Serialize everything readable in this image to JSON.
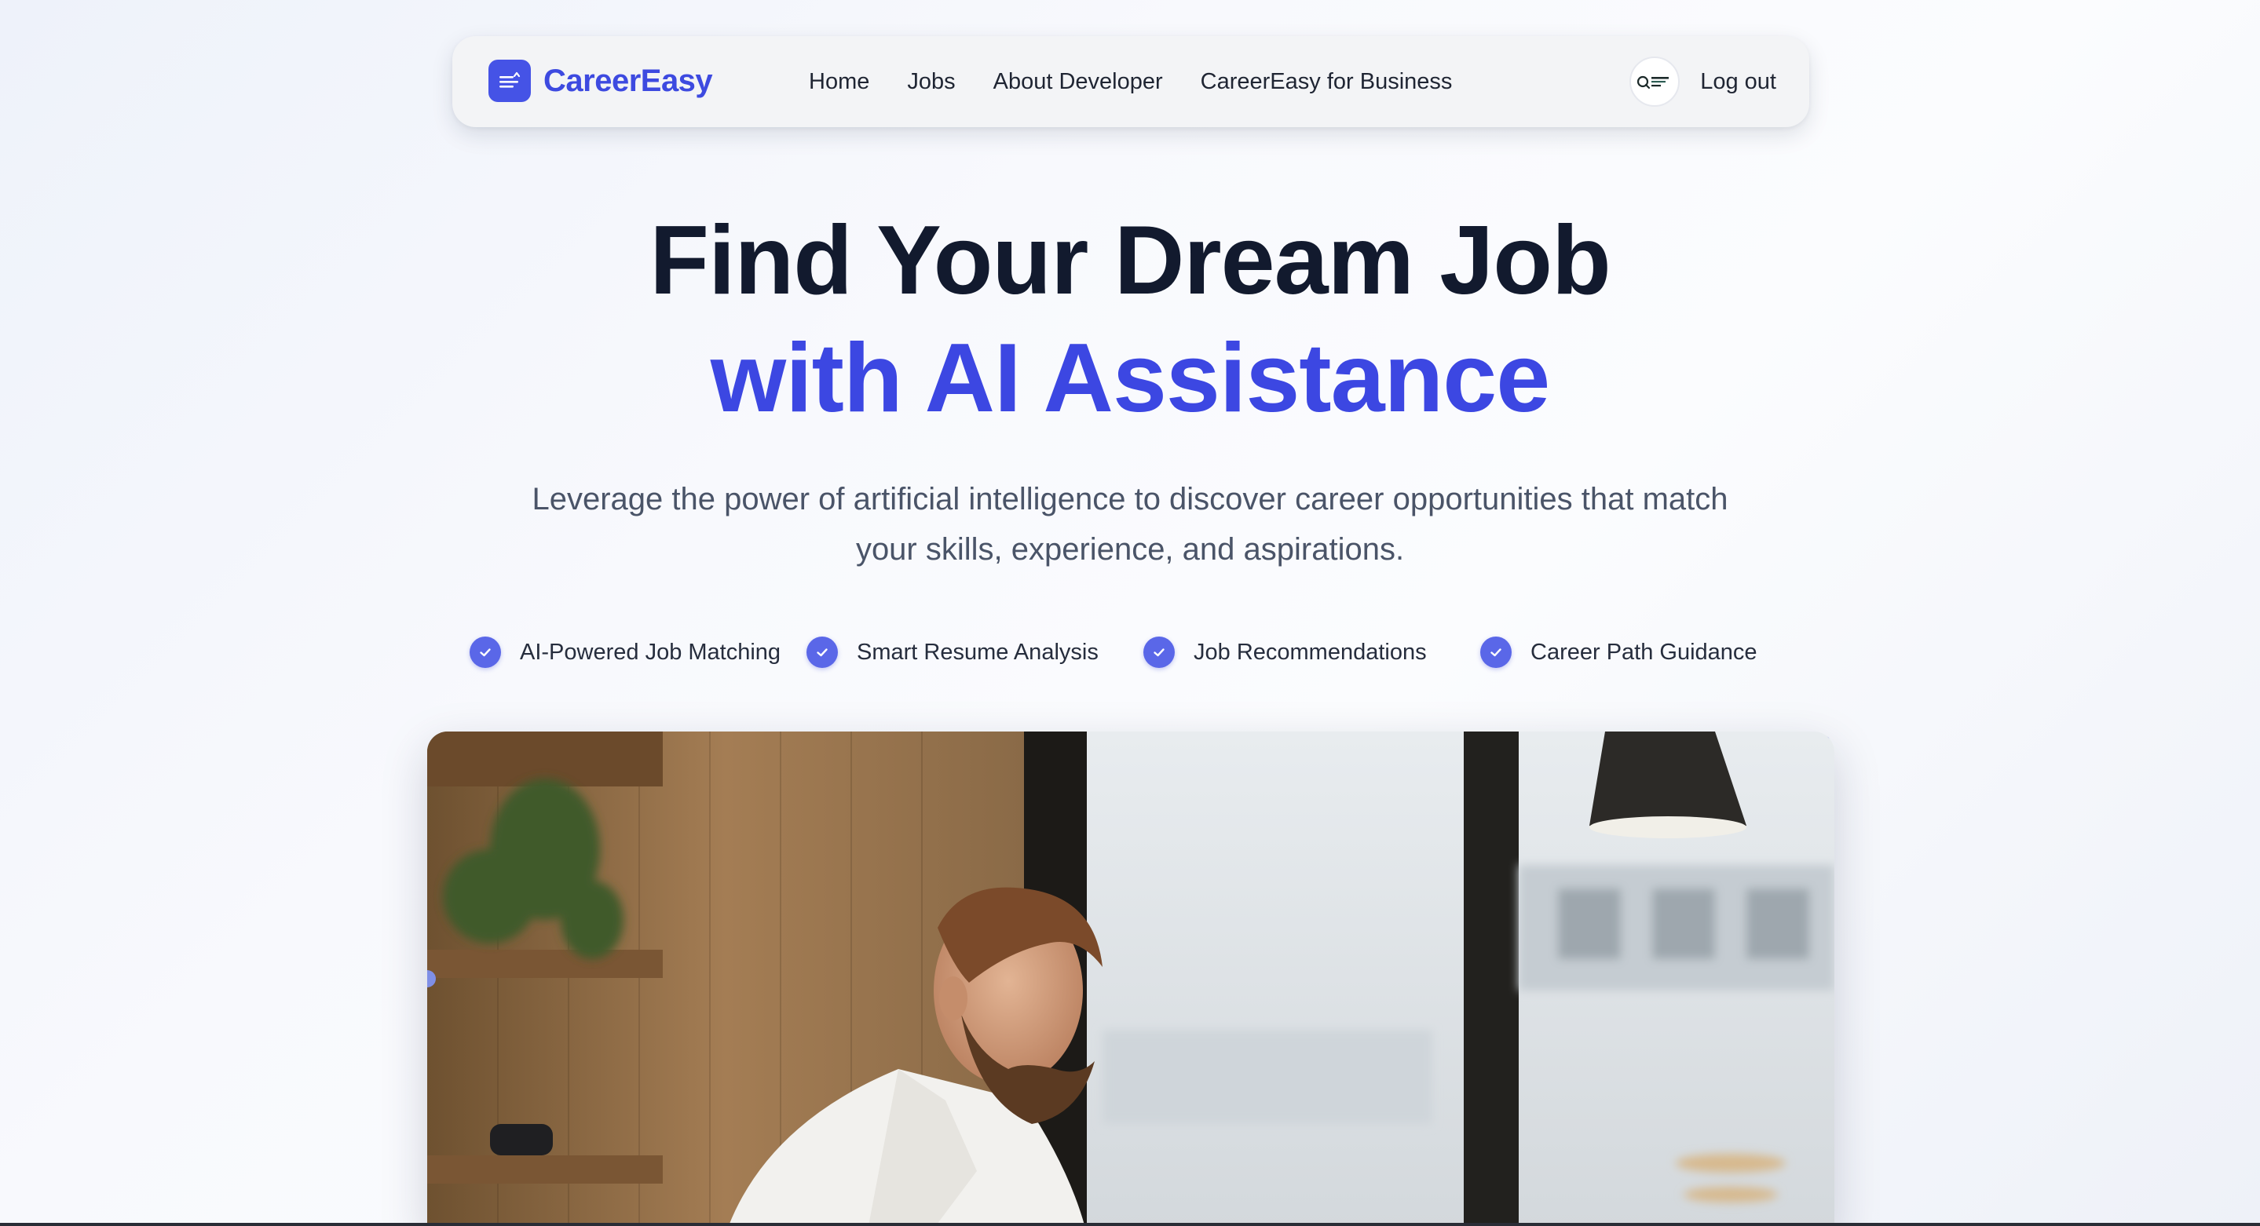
{
  "brand": {
    "name": "CareerEasy",
    "icon": "document-icon"
  },
  "nav": {
    "links": [
      "Home",
      "Jobs",
      "About Developer",
      "CareerEasy for Business"
    ],
    "avatar_icon": "careereasy-logo-icon",
    "logout_label": "Log out"
  },
  "hero": {
    "title_line1": "Find Your Dream Job",
    "title_line2": "with AI Assistance",
    "subtitle": "Leverage the power of artificial intelligence to discover career opportunities that match your skills, experience, and aspirations."
  },
  "features": [
    {
      "label": "AI-Powered Job Matching",
      "icon": "check-circle-icon"
    },
    {
      "label": "Smart Resume Analysis",
      "icon": "check-circle-icon"
    },
    {
      "label": "Job Recommendations",
      "icon": "check-circle-icon"
    },
    {
      "label": "Career Path Guidance",
      "icon": "check-circle-icon"
    }
  ],
  "photo": {
    "subject": "man-working-at-laptop-photo"
  },
  "colors": {
    "accent": "#3c47e2",
    "brand": "#3d4ae0",
    "heading": "#121a2e",
    "body_text": "#4a5468",
    "check": "#5a67e8"
  }
}
